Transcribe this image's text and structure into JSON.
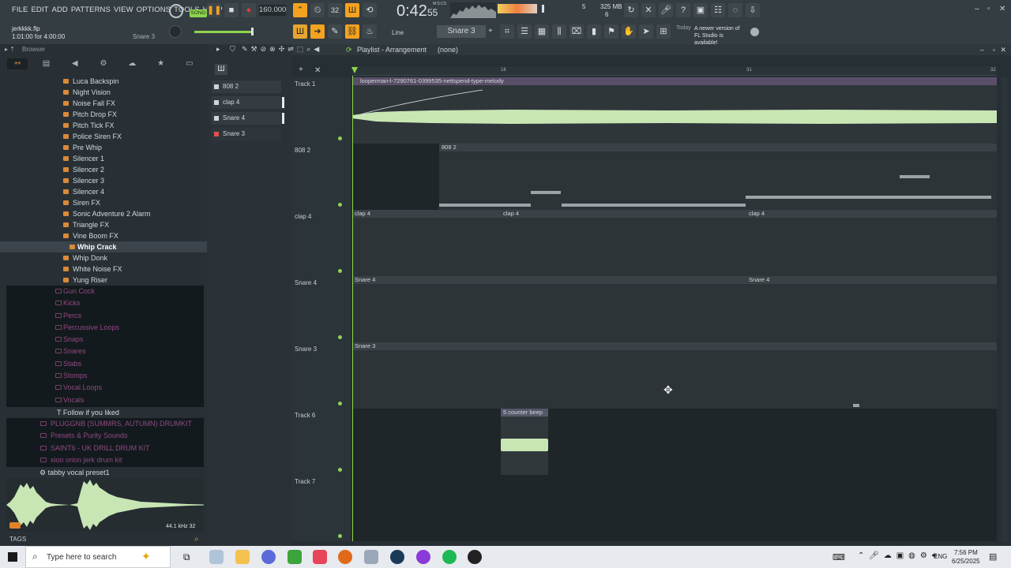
{
  "menu": [
    "FILE",
    "EDIT",
    "ADD",
    "PATTERNS",
    "VIEW",
    "OPTIONS",
    "TOOLS",
    "HELP"
  ],
  "transport": {
    "song_badge": "SONG",
    "tempo": "160.000",
    "time": "0:42",
    "time_sub": "55",
    "time_label": "M:S:CS",
    "cpu": "5",
    "mem": "325 MB",
    "poly": "6"
  },
  "project": {
    "file": "jerkkkk.flp",
    "info": "1:01:00 for 4:00:00",
    "pattern": "Snare 3"
  },
  "toolbar2": {
    "snap": "Line",
    "pattern_selector": "Snare 3",
    "news_date": "Today",
    "news_text": "A newer version of FL Studio is available!"
  },
  "browser": {
    "title": "Browser",
    "items": [
      "Luca Backspin",
      "Night Vision",
      "Noise Fall FX",
      "Pitch Drop FX",
      "Pitch Tick FX",
      "Police Siren FX",
      "Pre Whip",
      "Silencer 1",
      "Silencer 2",
      "Silencer 3",
      "Silencer 4",
      "Siren FX",
      "Sonic Adventure 2 Alarm",
      "Triangle FX",
      "Vine Boom FX",
      "Whip Crack",
      "Whip Donk",
      "White Noise FX",
      "Yung Riser"
    ],
    "selected": "Whip Crack",
    "folders": [
      "Gun Cock",
      "Kicks",
      "Percs",
      "Percussive Loops",
      "Snaps",
      "Snares",
      "Stabs",
      "Stomps",
      "Vocal Loops",
      "Vocals"
    ],
    "follow": "Follow if you liked",
    "packs": [
      "PLUGGNB (SUMMRS, AUTUMN) DRUMKIT",
      "Presets & Purity Sounds",
      "SAINT6 - UK DRILL DRUM KIT",
      "xion orion jerk drum kit"
    ],
    "preset": "tabby vocal preset1",
    "sample_info": "44.1 kHz 32",
    "tags": "TAGS"
  },
  "channels": [
    "808 2",
    "clap 4",
    "Snare 4",
    "Snare 3"
  ],
  "playlist": {
    "title": "Playlist - Arrangement",
    "pattern": "(none)",
    "bar_markers": [
      "16",
      "31",
      "32"
    ],
    "tracks": [
      {
        "name": "Track 1",
        "clip": "looperman-l-7290761-0399535-nettspend-type-melody"
      },
      {
        "name": "808 2",
        "clip": "808 2"
      },
      {
        "name": "clap 4",
        "clip": "clap 4"
      },
      {
        "name": "Snare 4",
        "clip": "Snare 4"
      },
      {
        "name": "Snare 3",
        "clip": "Snare 3"
      },
      {
        "name": "Track 6",
        "clip": "5 counter beep"
      },
      {
        "name": "Track 7",
        "clip": ""
      }
    ]
  },
  "taskbar": {
    "search": "Type here to search",
    "lang": "ENG",
    "time": "7:56 PM",
    "date": "6/25/2025"
  },
  "colors": {
    "accent": "#f4a21f",
    "audio_clip": "#c8e6b4",
    "bg": "#1f2629"
  }
}
